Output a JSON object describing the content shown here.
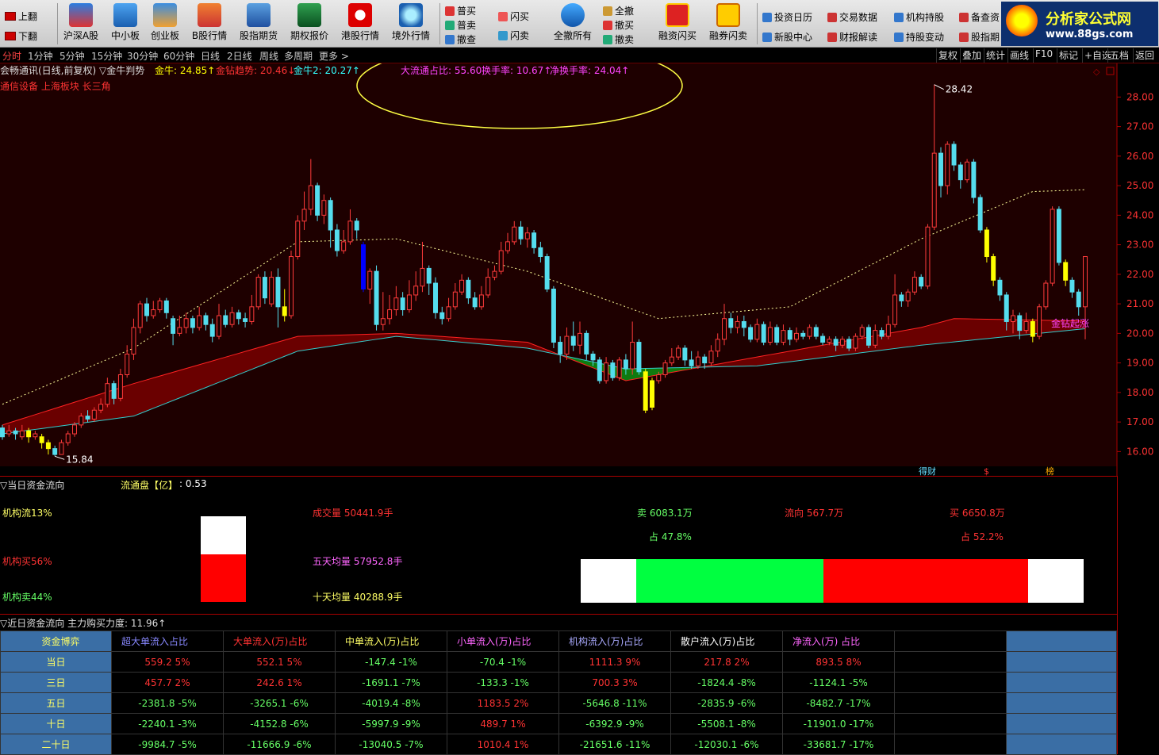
{
  "toolbar": {
    "page_up": "上翻",
    "page_down": "下翻",
    "buttons": [
      "沪深A股",
      "中小板",
      "创业板",
      "B股行情",
      "股指期货",
      "期权报价",
      "港股行情",
      "境外行情"
    ],
    "trade": {
      "buy1": "普买",
      "sell1": "普卖",
      "cancel": "撤查",
      "flash_buy": "闪买",
      "flash_sell": "闪卖",
      "cancel_all": "全撤所有",
      "all_cancel": "全撤",
      "cancel_buy": "撤买",
      "cancel_sell": "撤卖",
      "margin_buy": "融资闪买",
      "margin_sell": "融券闪卖"
    },
    "links": [
      "投资日历",
      "交易数据",
      "机构持股",
      "备查资",
      "新股中心",
      "财报解读",
      "持股变动",
      "股指期"
    ],
    "logo": "分析家公式网",
    "logo_url": "www.88gs.com"
  },
  "periods": [
    "分时",
    "1分钟",
    "5分钟",
    "15分钟",
    "30分钟",
    "60分钟",
    "日线",
    "2日线",
    "周线",
    "多周期",
    "更多 >"
  ],
  "right_tools": [
    "复权",
    "叠加",
    "统计",
    "画线",
    "F10",
    "标记",
    "+自选",
    "五档",
    "返回"
  ],
  "chart": {
    "title": "会畅通讯(日线,前复权) ▽金牛判势",
    "indicators": [
      {
        "label": "金牛: 24.85↑",
        "color": "#ffff00"
      },
      {
        "label": "金钻趋势: 20.46↓",
        "color": "#ff3333"
      },
      {
        "label": "金牛2: 20.27↑",
        "color": "#33ffff"
      },
      {
        "label": "大流通占比: 55.60",
        "color": "#ff44ff"
      },
      {
        "label": "换手率: 10.67↑",
        "color": "#ff44ff"
      },
      {
        "label": "净换手率: 24.04↑",
        "color": "#ff44ff"
      }
    ],
    "sector": "通信设备 上海板块 长三角",
    "high_label": "28.42",
    "low_label": "15.84",
    "annot": "金钻起涨",
    "yticks": [
      "28.00",
      "27.00",
      "26.00",
      "25.00",
      "24.00",
      "23.00",
      "22.00",
      "21.00",
      "20.00",
      "19.00",
      "18.00",
      "17.00",
      "16.00"
    ],
    "bottom_tags": [
      "得财",
      "$",
      "榜"
    ]
  },
  "chart_data": {
    "type": "candlestick",
    "ylim": [
      15.5,
      28.6
    ],
    "candles": [
      [
        16.8,
        16.5,
        16.9,
        16.4
      ],
      [
        16.6,
        16.7,
        16.9,
        16.5
      ],
      [
        16.7,
        16.6,
        16.8,
        16.4
      ],
      [
        16.5,
        16.7,
        16.9,
        16.4
      ],
      [
        16.7,
        16.5,
        16.8,
        16.3
      ],
      [
        16.5,
        16.6,
        16.7,
        16.4
      ],
      [
        16.5,
        16.3,
        16.6,
        16.1
      ],
      [
        16.3,
        16.1,
        16.4,
        15.9
      ],
      [
        16.1,
        15.9,
        16.2,
        15.84
      ],
      [
        15.9,
        16.3,
        16.4,
        15.9
      ],
      [
        16.3,
        16.6,
        16.7,
        16.2
      ],
      [
        16.6,
        16.9,
        17.0,
        16.5
      ],
      [
        16.9,
        17.2,
        17.3,
        16.8
      ],
      [
        17.2,
        17.1,
        17.4,
        17.0
      ],
      [
        17.1,
        17.4,
        17.5,
        17.0
      ],
      [
        17.4,
        17.6,
        17.8,
        17.3
      ],
      [
        17.6,
        18.3,
        18.5,
        17.5
      ],
      [
        18.3,
        17.8,
        18.4,
        17.6
      ],
      [
        17.8,
        18.6,
        18.8,
        17.7
      ],
      [
        18.6,
        19.3,
        19.6,
        18.5
      ],
      [
        19.3,
        20.2,
        20.5,
        19.1
      ],
      [
        20.2,
        21.0,
        21.1,
        20.0
      ],
      [
        21.0,
        20.6,
        21.2,
        20.4
      ],
      [
        20.6,
        20.8,
        21.1,
        20.5
      ],
      [
        20.8,
        21.1,
        21.2,
        20.7
      ],
      [
        21.1,
        20.7,
        21.2,
        20.5
      ],
      [
        20.5,
        20.0,
        20.6,
        19.6
      ],
      [
        20.0,
        20.2,
        20.6,
        19.9
      ],
      [
        20.2,
        20.5,
        20.7,
        20.0
      ],
      [
        20.5,
        20.2,
        20.6,
        20.0
      ],
      [
        20.2,
        20.6,
        20.9,
        20.1
      ],
      [
        20.6,
        20.3,
        20.7,
        20.1
      ],
      [
        20.3,
        19.9,
        20.5,
        19.7
      ],
      [
        19.9,
        20.6,
        21.0,
        19.8
      ],
      [
        20.6,
        20.3,
        20.8,
        20.2
      ],
      [
        20.3,
        20.7,
        20.9,
        20.2
      ],
      [
        20.7,
        20.5,
        20.8,
        20.3
      ],
      [
        20.5,
        20.4,
        20.7,
        20.2
      ],
      [
        20.4,
        20.9,
        21.3,
        20.3
      ],
      [
        20.9,
        21.9,
        22.0,
        20.8
      ],
      [
        21.9,
        21.2,
        22.1,
        21.0
      ],
      [
        21.0,
        21.9,
        22.1,
        20.9
      ],
      [
        21.9,
        20.9,
        22.2,
        20.2
      ],
      [
        20.9,
        20.6,
        21.5,
        20.4
      ],
      [
        20.6,
        22.6,
        22.8,
        20.5
      ],
      [
        22.6,
        23.8,
        24.0,
        22.5
      ],
      [
        23.8,
        24.2,
        24.8,
        23.5
      ],
      [
        24.2,
        25.0,
        25.9,
        24.0
      ],
      [
        25.0,
        24.0,
        25.1,
        23.8
      ],
      [
        24.0,
        24.5,
        24.7,
        23.7
      ],
      [
        24.5,
        23.5,
        24.6,
        22.9
      ],
      [
        23.5,
        22.8,
        23.7,
        22.6
      ],
      [
        22.8,
        23.1,
        23.5,
        22.7
      ],
      [
        23.1,
        23.8,
        24.2,
        23.0
      ],
      [
        23.8,
        23.5,
        23.9,
        23.2
      ],
      [
        23.0,
        21.5,
        23.1,
        21.4
      ],
      [
        21.5,
        22.1,
        22.2,
        21.0
      ],
      [
        22.1,
        20.3,
        22.3,
        20.1
      ],
      [
        20.3,
        20.5,
        21.4,
        20.1
      ],
      [
        20.5,
        20.8,
        21.3,
        20.3
      ],
      [
        20.8,
        21.2,
        21.6,
        20.6
      ],
      [
        21.2,
        20.8,
        21.4,
        20.6
      ],
      [
        20.8,
        21.3,
        21.8,
        20.7
      ],
      [
        21.3,
        21.6,
        22.1,
        21.1
      ],
      [
        21.6,
        22.2,
        23.1,
        21.4
      ],
      [
        22.2,
        21.7,
        22.3,
        21.3
      ],
      [
        21.7,
        20.7,
        21.9,
        20.5
      ],
      [
        20.7,
        20.5,
        20.9,
        20.3
      ],
      [
        20.5,
        20.9,
        21.2,
        20.4
      ],
      [
        20.9,
        21.4,
        21.7,
        20.8
      ],
      [
        21.4,
        21.8,
        22.0,
        21.3
      ],
      [
        21.8,
        21.2,
        21.9,
        21.0
      ],
      [
        21.2,
        20.9,
        21.4,
        20.8
      ],
      [
        20.9,
        21.3,
        21.6,
        20.8
      ],
      [
        21.3,
        21.9,
        22.2,
        21.2
      ],
      [
        21.9,
        22.1,
        22.3,
        21.8
      ],
      [
        22.1,
        22.8,
        23.1,
        22.0
      ],
      [
        22.8,
        23.1,
        23.4,
        22.7
      ],
      [
        23.1,
        23.6,
        23.8,
        23.0
      ],
      [
        23.6,
        23.2,
        23.8,
        23.0
      ],
      [
        23.2,
        23.4,
        23.6,
        22.9
      ],
      [
        23.4,
        22.9,
        23.5,
        22.7
      ],
      [
        22.9,
        22.6,
        23.1,
        22.4
      ],
      [
        22.6,
        21.5,
        22.7,
        21.4
      ],
      [
        21.5,
        19.7,
        21.6,
        19.5
      ],
      [
        19.7,
        19.3,
        19.9,
        19.0
      ],
      [
        19.3,
        19.9,
        20.2,
        19.1
      ],
      [
        19.9,
        19.6,
        20.4,
        19.4
      ],
      [
        19.6,
        20.0,
        20.4,
        19.3
      ],
      [
        20.0,
        19.3,
        20.1,
        19.1
      ],
      [
        19.3,
        19.1,
        19.4,
        18.9
      ],
      [
        19.1,
        18.4,
        19.2,
        18.3
      ],
      [
        18.4,
        19.0,
        19.2,
        18.3
      ],
      [
        19.0,
        18.5,
        19.1,
        18.4
      ],
      [
        18.5,
        19.1,
        19.2,
        18.4
      ],
      [
        19.1,
        18.8,
        19.3,
        18.6
      ],
      [
        18.8,
        19.7,
        20.4,
        18.6
      ],
      [
        19.7,
        18.7,
        19.8,
        18.6
      ],
      [
        18.7,
        17.4,
        18.8,
        17.3
      ],
      [
        17.5,
        18.4,
        18.5,
        17.4
      ],
      [
        18.4,
        18.6,
        18.7,
        18.3
      ],
      [
        18.6,
        19.0,
        19.1,
        18.5
      ],
      [
        19.0,
        19.2,
        19.5,
        18.9
      ],
      [
        19.2,
        19.5,
        19.6,
        19.1
      ],
      [
        19.5,
        19.1,
        19.6,
        18.9
      ],
      [
        19.1,
        18.9,
        19.4,
        18.8
      ],
      [
        18.9,
        19.2,
        19.4,
        18.8
      ],
      [
        19.2,
        19.0,
        19.3,
        18.8
      ],
      [
        19.0,
        19.4,
        19.6,
        18.9
      ],
      [
        19.4,
        19.8,
        20.0,
        19.2
      ],
      [
        19.8,
        20.5,
        21.0,
        19.6
      ],
      [
        20.5,
        20.2,
        20.7,
        20.0
      ],
      [
        20.2,
        20.4,
        20.6,
        20.0
      ],
      [
        20.4,
        20.2,
        20.6,
        19.9
      ],
      [
        20.2,
        19.8,
        20.3,
        19.7
      ],
      [
        19.8,
        20.3,
        20.5,
        19.7
      ],
      [
        20.3,
        19.7,
        20.4,
        19.6
      ],
      [
        19.7,
        20.2,
        20.4,
        19.6
      ],
      [
        20.2,
        19.7,
        20.3,
        19.6
      ],
      [
        19.7,
        20.1,
        20.3,
        19.6
      ],
      [
        20.1,
        19.8,
        20.2,
        19.6
      ],
      [
        19.8,
        20.0,
        20.2,
        19.7
      ],
      [
        20.0,
        19.9,
        20.1,
        19.8
      ],
      [
        19.9,
        20.2,
        20.3,
        19.8
      ],
      [
        20.2,
        19.9,
        20.3,
        19.8
      ],
      [
        19.9,
        19.7,
        20.0,
        19.6
      ],
      [
        19.7,
        19.8,
        19.9,
        19.6
      ],
      [
        19.8,
        19.6,
        19.9,
        19.4
      ],
      [
        19.6,
        19.8,
        19.9,
        19.5
      ],
      [
        19.8,
        19.5,
        19.9,
        19.4
      ],
      [
        19.5,
        19.9,
        20.0,
        19.4
      ],
      [
        19.9,
        20.2,
        20.3,
        19.8
      ],
      [
        20.2,
        19.6,
        20.3,
        19.5
      ],
      [
        19.6,
        20.1,
        20.3,
        19.5
      ],
      [
        20.1,
        19.9,
        20.2,
        19.8
      ],
      [
        19.9,
        20.3,
        20.6,
        19.8
      ],
      [
        20.3,
        21.3,
        22.0,
        20.2
      ],
      [
        21.3,
        21.1,
        21.4,
        20.9
      ],
      [
        21.1,
        21.4,
        21.5,
        20.9
      ],
      [
        21.4,
        21.9,
        22.1,
        21.3
      ],
      [
        21.9,
        21.6,
        22.0,
        21.5
      ],
      [
        21.6,
        23.6,
        23.7,
        21.5
      ],
      [
        23.6,
        26.1,
        28.42,
        23.5
      ],
      [
        26.1,
        25.0,
        26.3,
        24.6
      ],
      [
        25.0,
        26.4,
        26.5,
        24.7
      ],
      [
        26.4,
        25.7,
        26.5,
        25.5
      ],
      [
        25.7,
        25.2,
        25.8,
        24.9
      ],
      [
        25.2,
        25.8,
        25.9,
        25.1
      ],
      [
        25.8,
        24.6,
        25.9,
        24.4
      ],
      [
        24.6,
        23.5,
        24.7,
        23.4
      ],
      [
        23.5,
        22.6,
        23.6,
        22.4
      ],
      [
        22.6,
        21.8,
        22.7,
        21.6
      ],
      [
        21.8,
        21.3,
        21.9,
        21.1
      ],
      [
        21.3,
        20.4,
        21.4,
        20.1
      ],
      [
        20.4,
        20.6,
        20.8,
        20.0
      ],
      [
        20.6,
        20.1,
        20.7,
        19.8
      ],
      [
        20.1,
        20.4,
        20.7,
        20.0
      ],
      [
        20.4,
        19.9,
        20.5,
        19.7
      ],
      [
        19.9,
        20.9,
        21.0,
        19.8
      ],
      [
        20.9,
        21.7,
        21.8,
        20.8
      ],
      [
        21.7,
        24.2,
        24.3,
        21.6
      ],
      [
        24.2,
        22.4,
        24.3,
        22.3
      ],
      [
        22.4,
        21.8,
        22.5,
        21.6
      ],
      [
        21.8,
        21.4,
        21.9,
        21.2
      ],
      [
        21.4,
        20.9,
        21.5,
        20.6
      ],
      [
        20.9,
        22.6,
        22.6,
        19.8
      ]
    ],
    "ma_slow": [
      [
        0,
        17.6
      ],
      [
        20,
        19.5
      ],
      [
        45,
        23.1
      ],
      [
        60,
        23.2
      ],
      [
        80,
        22.1
      ],
      [
        100,
        20.5
      ],
      [
        120,
        20.9
      ],
      [
        140,
        23.2
      ],
      [
        157,
        24.8
      ],
      [
        170,
        24.9
      ]
    ],
    "ma_trend": [
      [
        0,
        16.9
      ],
      [
        20,
        18.3
      ],
      [
        45,
        19.9
      ],
      [
        60,
        20.0
      ],
      [
        80,
        19.7
      ],
      [
        95,
        18.4
      ],
      [
        110,
        19.0
      ],
      [
        140,
        20.2
      ],
      [
        145,
        20.5
      ],
      [
        170,
        20.4
      ]
    ],
    "ma_fast": [
      [
        0,
        16.6
      ],
      [
        20,
        17.2
      ],
      [
        45,
        19.4
      ],
      [
        60,
        19.9
      ],
      [
        80,
        19.5
      ],
      [
        95,
        18.8
      ],
      [
        115,
        18.9
      ],
      [
        140,
        19.6
      ],
      [
        170,
        20.27
      ]
    ]
  },
  "capflow": {
    "title": "▽当日资金流向",
    "float_label": "流通盘【亿】",
    "float_value": ": 0.53",
    "inst_flow": "机构流13%",
    "inst_buy": "机构买56%",
    "inst_sell": "机构卖44%",
    "volume": "成交量 50441.9手",
    "avg5": "五天均量 57952.8手",
    "avg10": "十天均量 40288.9手",
    "sell": "卖 6083.1万",
    "sell_pct": "占 47.8%",
    "flow": "流向 567.7万",
    "buy": "买 6650.8万",
    "buy_pct": "占 52.2%",
    "inst_buy_ratio": 0.56,
    "sell_ratio": 0.478,
    "buy_ratio": 0.522
  },
  "bottom": {
    "title": "▽近日资金流向 主力购买力度: 11.96↑",
    "headers": [
      "资金博弈",
      "超大单流入占比",
      "大单流入(万)占比",
      "中单流入(万)占比",
      "小单流入(万)占比",
      "机构流入(万)占比",
      "散户流入(万)占比",
      "净流入(万) 占比"
    ],
    "header_colors": [
      "#ffff66",
      "#8888ff",
      "#ff3333",
      "#ffff66",
      "#ff66ff",
      "#aaaaff",
      "#ffffff",
      "#ff66ff"
    ],
    "rows": [
      {
        "label": "当日",
        "cells": [
          "559.2 5%",
          "552.1 5%",
          "-147.4 -1%",
          "-70.4 -1%",
          "1111.3 9%",
          "217.8 2%",
          "893.5 8%"
        ]
      },
      {
        "label": "三日",
        "cells": [
          "457.7 2%",
          "242.6 1%",
          "-1691.1 -7%",
          "-133.3 -1%",
          "700.3 3%",
          "-1824.4 -8%",
          "-1124.1 -5%"
        ]
      },
      {
        "label": "五日",
        "cells": [
          "-2381.8 -5%",
          "-3265.1 -6%",
          "-4019.4 -8%",
          "1183.5 2%",
          "-5646.8 -11%",
          "-2835.9 -6%",
          "-8482.7 -17%"
        ]
      },
      {
        "label": "十日",
        "cells": [
          "-2240.1 -3%",
          "-4152.8 -6%",
          "-5997.9 -9%",
          "489.7 1%",
          "-6392.9 -9%",
          "-5508.1 -8%",
          "-11901.0 -17%"
        ]
      },
      {
        "label": "二十日",
        "cells": [
          "-9984.7 -5%",
          "-11666.9 -6%",
          "-13040.5 -7%",
          "1010.4 1%",
          "-21651.6 -11%",
          "-12030.1 -6%",
          "-33681.7 -17%"
        ]
      }
    ]
  }
}
